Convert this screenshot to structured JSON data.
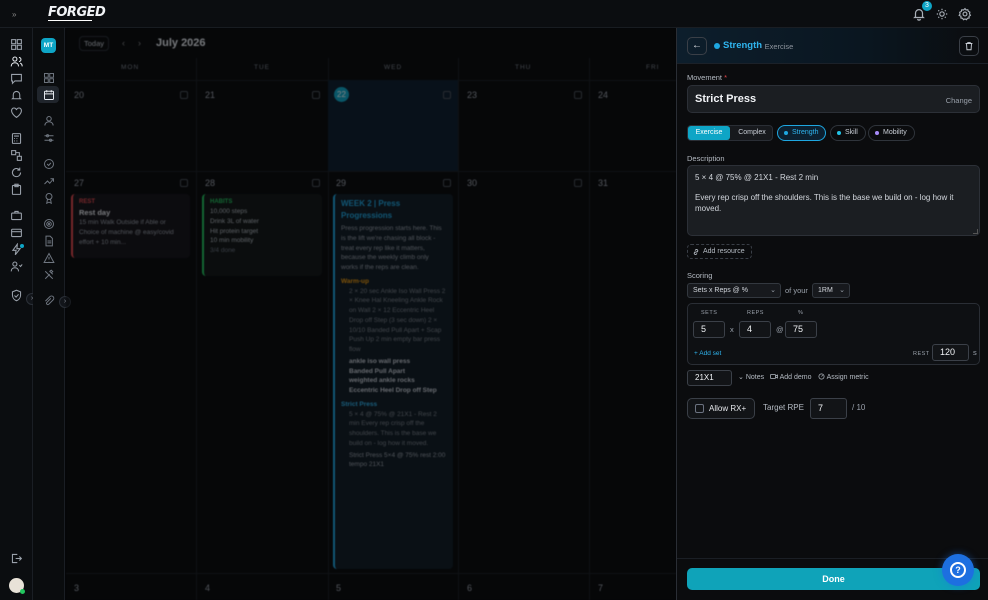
{
  "app": {
    "logo": "FORGED",
    "notifications_count": "3",
    "user_initials": "MT"
  },
  "calendar": {
    "today_label": "Today",
    "month_label": "July 2026",
    "day_headers": [
      "MON",
      "TUE",
      "WED",
      "THU",
      "FRI"
    ],
    "week1_dates": [
      "20",
      "21",
      "22",
      "23",
      "24"
    ],
    "week2_dates": [
      "27",
      "28",
      "29",
      "30",
      "31"
    ],
    "week3_dates": [
      "3",
      "4",
      "5",
      "6",
      "7"
    ],
    "rest_card": {
      "tag": "REST",
      "title": "Rest day",
      "body": "15 min Walk Outside if Able or Choice of machine @ easy/covid effort + 10 min..."
    },
    "habits_card": {
      "tag": "HABITS",
      "items": [
        "10,000 steps",
        "Drink 3L of water",
        "Hit protein target",
        "10 min mobility"
      ],
      "more": "3/4 done"
    },
    "workout_card": {
      "title": "WEEK 2 | Press Progressions",
      "intro": "Press progression starts here. This is the lift we're chasing all block - treat every rep like it matters, because the weekly climb only works if the reps are clean.",
      "warmup_title": "Warm-up",
      "warmup_body": "2 × 20 sec Ankle Iso Wall Press 2 × Knee Hal Kneeling Ankle Rock on Wall 2 × 12 Eccentric Heel Drop off Step (3 sec down) 2 × 10/10 Banded Pull Apart + Scap Push Up 2 min empty bar press flow",
      "warmup_items": [
        "ankle iso wall press",
        "Banded Pull Apart",
        "weighted ankle rocks",
        "Eccentric Heel Drop off Step"
      ],
      "strict_title": "Strict Press",
      "strict_body": "5 × 4 @ 75% @ 21X1 - Rest 2 min Every rep crisp off the shoulders. This is the base we build on - log how it moved.",
      "strict_footer": "Strict Press  5×4 @ 75% rest 2:00 tempo 21X1"
    }
  },
  "panel": {
    "header_title": "Strength",
    "header_subtitle": "· Exercise",
    "movement_label": "Movement",
    "movement_required": "*",
    "movement_name": "Strict Press",
    "change_label": "Change",
    "type_tabs": [
      "Exercise",
      "Complex"
    ],
    "category_pills": [
      {
        "label": "Strength",
        "color": "#1ea7e1",
        "selected": true
      },
      {
        "label": "Skill",
        "color": "#22c3e6",
        "selected": false
      },
      {
        "label": "Mobility",
        "color": "#a78bfa",
        "selected": false
      }
    ],
    "description_label": "Description",
    "description_line1": "5 × 4 @ 75% @ 21X1 - Rest 2 min",
    "description_line2": "Every rep crisp off the shoulders. This is the base we build on - log how it moved.",
    "add_resource": "Add resource",
    "scoring_label": "Scoring",
    "scoring_type": "Sets x Reps @ %",
    "of_your": "of your",
    "reference": "1RM",
    "sets_label": "SETS",
    "reps_label": "REPS",
    "pct_label": "%",
    "sets_value": "5",
    "reps_value": "4",
    "pct_value": "75",
    "x_symbol": "x",
    "at_symbol": "@",
    "add_set": "+ Add set",
    "rest_label": "REST",
    "rest_value": "120",
    "rest_unit": "s",
    "tempo_value": "21X1",
    "notes_label": "Notes",
    "add_demo_label": "Add demo",
    "assign_metric_label": "Assign metric",
    "allow_rx_label": "Allow RX+",
    "target_rpe_label": "Target RPE",
    "rpe_value": "7",
    "rpe_max": "/ 10",
    "done_label": "Done"
  }
}
